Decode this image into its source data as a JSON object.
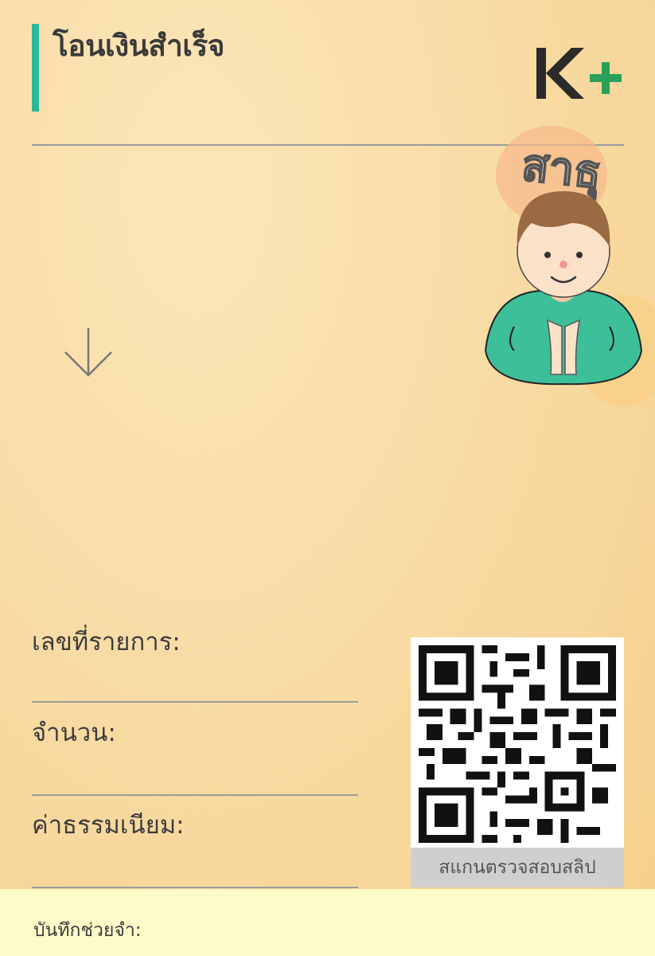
{
  "header": {
    "title": "โอนเงินสำเร็จ"
  },
  "logo": {
    "mark": "K+",
    "colors": {
      "k": "#2b2b2b",
      "plus": "#2ca05a"
    }
  },
  "mascot": {
    "greeting": "สาธุ",
    "icon": "wai-boy-icon"
  },
  "arrow": {
    "icon": "arrow-down-icon"
  },
  "fields": {
    "transaction_id": "เลขที่รายการ:",
    "amount": "จำนวน:",
    "fee": "ค่าธรรมเนียม:"
  },
  "qr": {
    "caption": "สแกนตรวจสอบสลิป",
    "icon": "qr-code-icon"
  },
  "memo": {
    "label": "บันทึกช่วยจำ:"
  },
  "colors": {
    "accent": "#2cb898",
    "background": "#f8dca6",
    "memo_bg": "#fefbc8"
  }
}
